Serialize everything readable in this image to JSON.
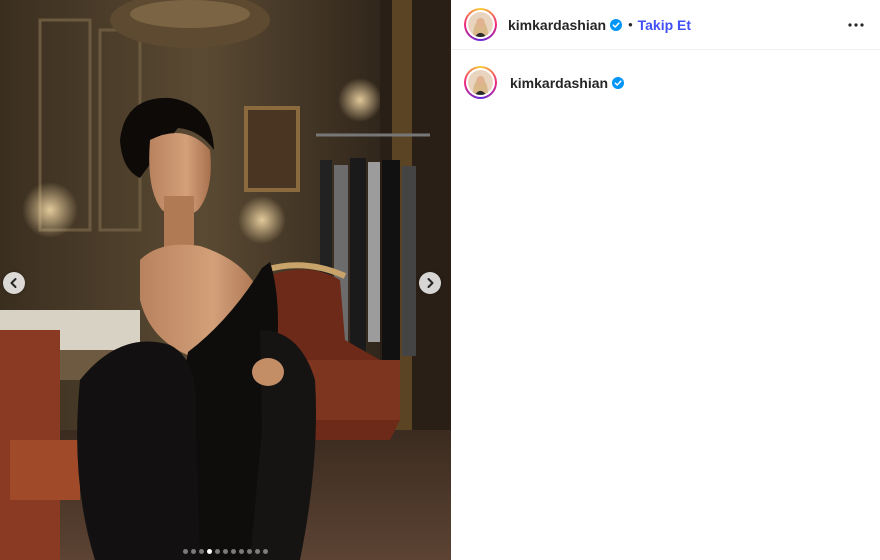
{
  "post": {
    "username": "kimkardashian",
    "verified": true,
    "follow_label": "Takip Et",
    "separator": "•",
    "carousel": {
      "total_slides": 11,
      "current_slide": 4
    }
  },
  "colors": {
    "follow": "#4150f7",
    "verified": "#0095f6",
    "text": "#262626"
  },
  "icons": {
    "prev": "chevron-left-icon",
    "next": "chevron-right-icon",
    "more": "more-options-icon",
    "verified": "verified-badge-icon"
  }
}
